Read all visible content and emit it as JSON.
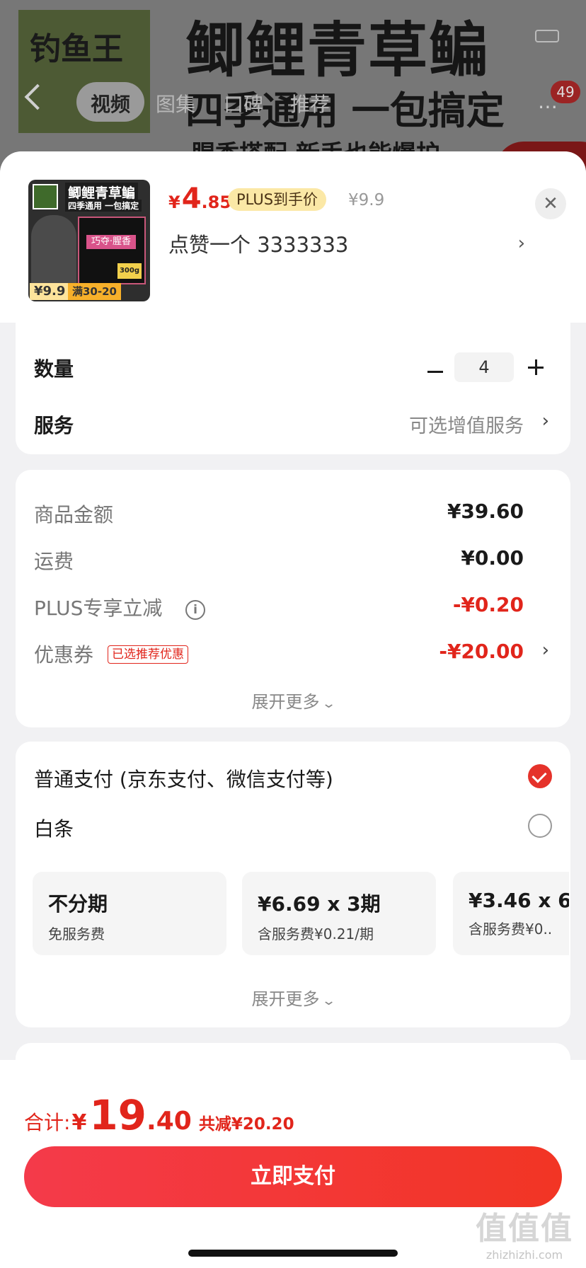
{
  "background": {
    "logo_text": "钓鱼王",
    "title": "鲫鲤青草鳊",
    "subtitle": "四季通用 一包搞定",
    "subtitle2": "腥香搭配 新手也能爆护",
    "tabs": [
      {
        "label": "视频",
        "active": true
      },
      {
        "label": "图集",
        "active": false
      },
      {
        "label": "口碑",
        "active": false
      },
      {
        "label": "推荐",
        "active": false
      }
    ],
    "cart_badge": "49",
    "more_icon": "more-dots-icon"
  },
  "product": {
    "thumb": {
      "title": "鲫鲤青草鳊",
      "subtitle": "四季通用 一包搞定",
      "bag_label": "巧夺·腥香",
      "weight": "300g",
      "price_badge": "¥9.9",
      "deal_badge": "满30-20"
    },
    "price_currency": "¥",
    "price_int": "4",
    "price_dec": ".85",
    "plus_tag": "PLUS到手价",
    "original_price": "¥9.9",
    "spec_text": "点赞一个  3333333",
    "close_label": "✕"
  },
  "quantity": {
    "label": "数量",
    "value": "4"
  },
  "service": {
    "label": "服务",
    "value": "可选增值服务"
  },
  "fees": {
    "rows": [
      {
        "label": "商品金额",
        "value": "¥39.60"
      },
      {
        "label": "运费",
        "value": "¥0.00"
      },
      {
        "label": "PLUS专享立减",
        "value": "-¥0.20"
      },
      {
        "label": "优惠券",
        "value": "-¥20.00",
        "tag": "已选推荐优惠"
      }
    ],
    "expand_label": "展开更多"
  },
  "payment": {
    "methods": [
      {
        "label": "普通支付 (京东支付、微信支付等)",
        "selected": true
      },
      {
        "label": "白条",
        "selected": false
      }
    ],
    "plans": [
      {
        "title": "不分期",
        "sub": "免服务费"
      },
      {
        "title": "¥6.69 x 3期",
        "sub": "含服务费¥0.21/期"
      },
      {
        "title": "¥3.46 x 6",
        "sub": "含服务费¥0.."
      }
    ],
    "expand_label": "展开更多"
  },
  "footer": {
    "total_label": "合计:",
    "total_currency": "¥",
    "total_int": "19",
    "total_dec": ".40",
    "saved": "共减¥20.20",
    "pay_button": "立即支付",
    "watermark": "值值值",
    "watermark_url": "zhizhizhi.com"
  },
  "colors": {
    "accent": "#e1251b",
    "pay_button": "#f23524",
    "plus_tag_bg": "#fbe8a6"
  }
}
